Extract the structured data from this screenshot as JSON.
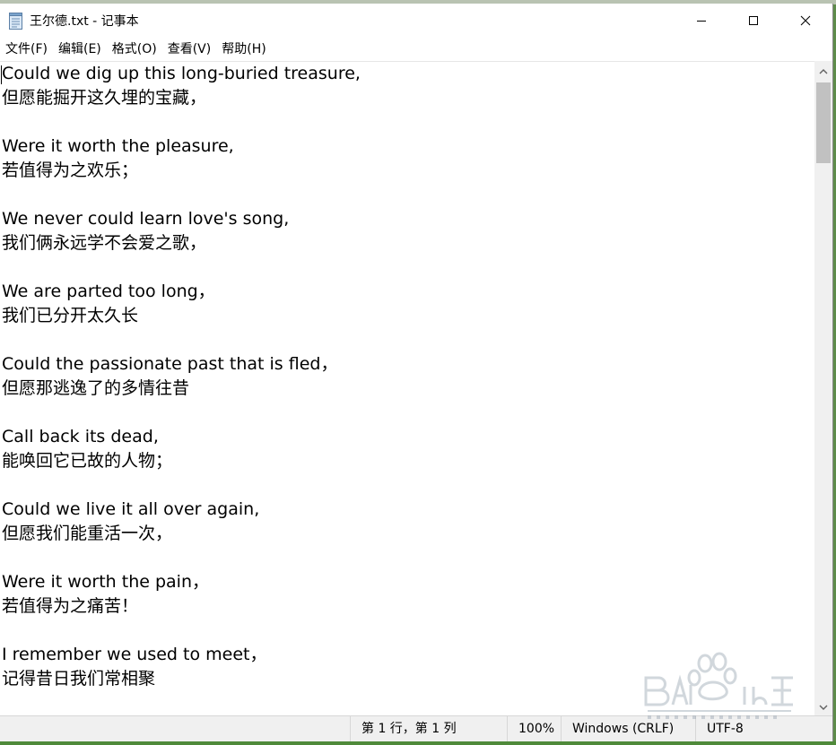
{
  "window": {
    "title": "王尔德.txt - 记事本"
  },
  "menu": [
    {
      "label": "文件(F)"
    },
    {
      "label": "编辑(E)"
    },
    {
      "label": "格式(O)"
    },
    {
      "label": "查看(V)"
    },
    {
      "label": "帮助(H)"
    }
  ],
  "document": {
    "lines": [
      "Could we dig up this long-buried treasure,",
      "但愿能掘开这久埋的宝藏，",
      "",
      "Were it worth the pleasure,",
      "若值得为之欢乐；",
      "",
      "We never could learn love's song,",
      "我们俩永远学不会爱之歌，",
      "",
      "We are parted too long，",
      "我们已分开太久长",
      "",
      "Could the passionate past that is fled，",
      "但愿那逃逸了的多情往昔",
      "",
      "Call back its dead,",
      "能唤回它已故的人物；",
      "",
      "Could we live it all over again,",
      "但愿我们能重活一次，",
      "",
      "Were it worth the pain，",
      "若值得为之痛苦！",
      "",
      "I remember we used to meet，",
      "记得昔日我们常相聚"
    ]
  },
  "statusbar": {
    "position": "第 1 行，第 1 列",
    "zoom": "100%",
    "line_ending": "Windows (CRLF)",
    "encoding": "UTF-8"
  },
  "icons": {
    "app": "notepad-icon",
    "minimize": "minimize-icon",
    "maximize": "maximize-icon",
    "close": "close-icon",
    "scroll_up": "chevron-up-icon",
    "scroll_down": "chevron-down-icon",
    "watermark": "baidu-jingyan-logo"
  },
  "colors": {
    "text": "#000000",
    "background": "#ffffff",
    "statusbar": "#f0f0f0",
    "scrollbar_thumb": "#c1c1c1"
  }
}
